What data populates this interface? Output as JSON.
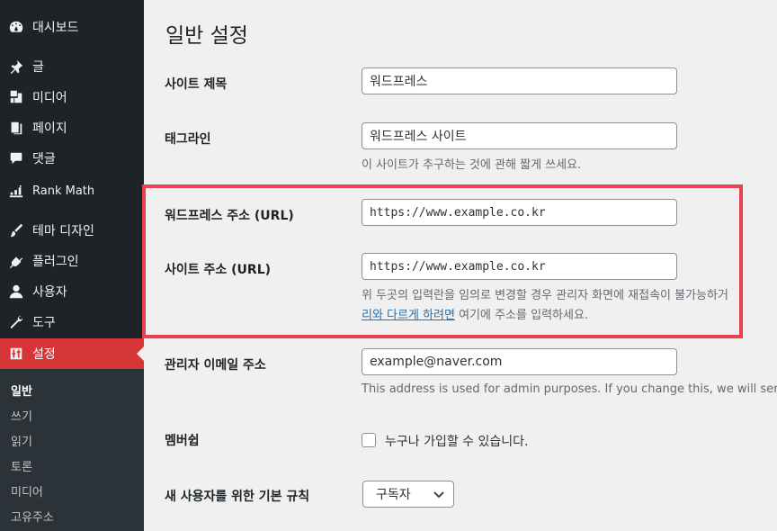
{
  "sidebar": {
    "items": [
      {
        "label": "대시보드",
        "icon": "dashboard-icon"
      },
      {
        "label": "글",
        "icon": "pin-icon"
      },
      {
        "label": "미디어",
        "icon": "media-icon"
      },
      {
        "label": "페이지",
        "icon": "page-icon"
      },
      {
        "label": "댓글",
        "icon": "comment-icon"
      },
      {
        "label": "Rank Math",
        "icon": "rank-math-icon"
      },
      {
        "label": "테마 디자인",
        "icon": "brush-icon"
      },
      {
        "label": "플러그인",
        "icon": "plugin-icon"
      },
      {
        "label": "사용자",
        "icon": "user-icon"
      },
      {
        "label": "도구",
        "icon": "wrench-icon"
      },
      {
        "label": "설정",
        "icon": "settings-icon",
        "active": true
      }
    ],
    "submenu": [
      "일반",
      "쓰기",
      "읽기",
      "토론",
      "미디어",
      "고유주소"
    ]
  },
  "page": {
    "title": "일반 설정",
    "site_title": {
      "label": "사이트 제목",
      "value": "워드프레스"
    },
    "tagline": {
      "label": "태그라인",
      "value": "워드프레스 사이트",
      "description": "이 사이트가 추구하는 것에 관해 짧게 쓰세요."
    },
    "wp_address": {
      "label": "워드프레스 주소 (URL)",
      "value": "https://www.example.co.kr"
    },
    "site_address": {
      "label": "사이트 주소 (URL)",
      "value": "https://www.example.co.kr",
      "description_line1": "위 두곳의 입력란을 임의로 변경할 경우 관리자 화면에 재접속이 불가능하거",
      "description_link": "리와 다르게 하려면",
      "description_line2_rest": " 여기에 주소를 입력하세요."
    },
    "admin_email": {
      "label": "관리자 이메일 주소",
      "value": "example@naver.com",
      "description": "This address is used for admin purposes. If you change this, we will send you"
    },
    "membership": {
      "label": "멤버쉽",
      "checkbox_label": "누구나 가입할 수 있습니다.",
      "checked": false
    },
    "default_role": {
      "label": "새 사용자를 위한 기본 규칙",
      "value": "구독자"
    }
  },
  "colors": {
    "active_menu": "#d63638",
    "highlight_box": "#e8424e",
    "link": "#2271b1"
  }
}
